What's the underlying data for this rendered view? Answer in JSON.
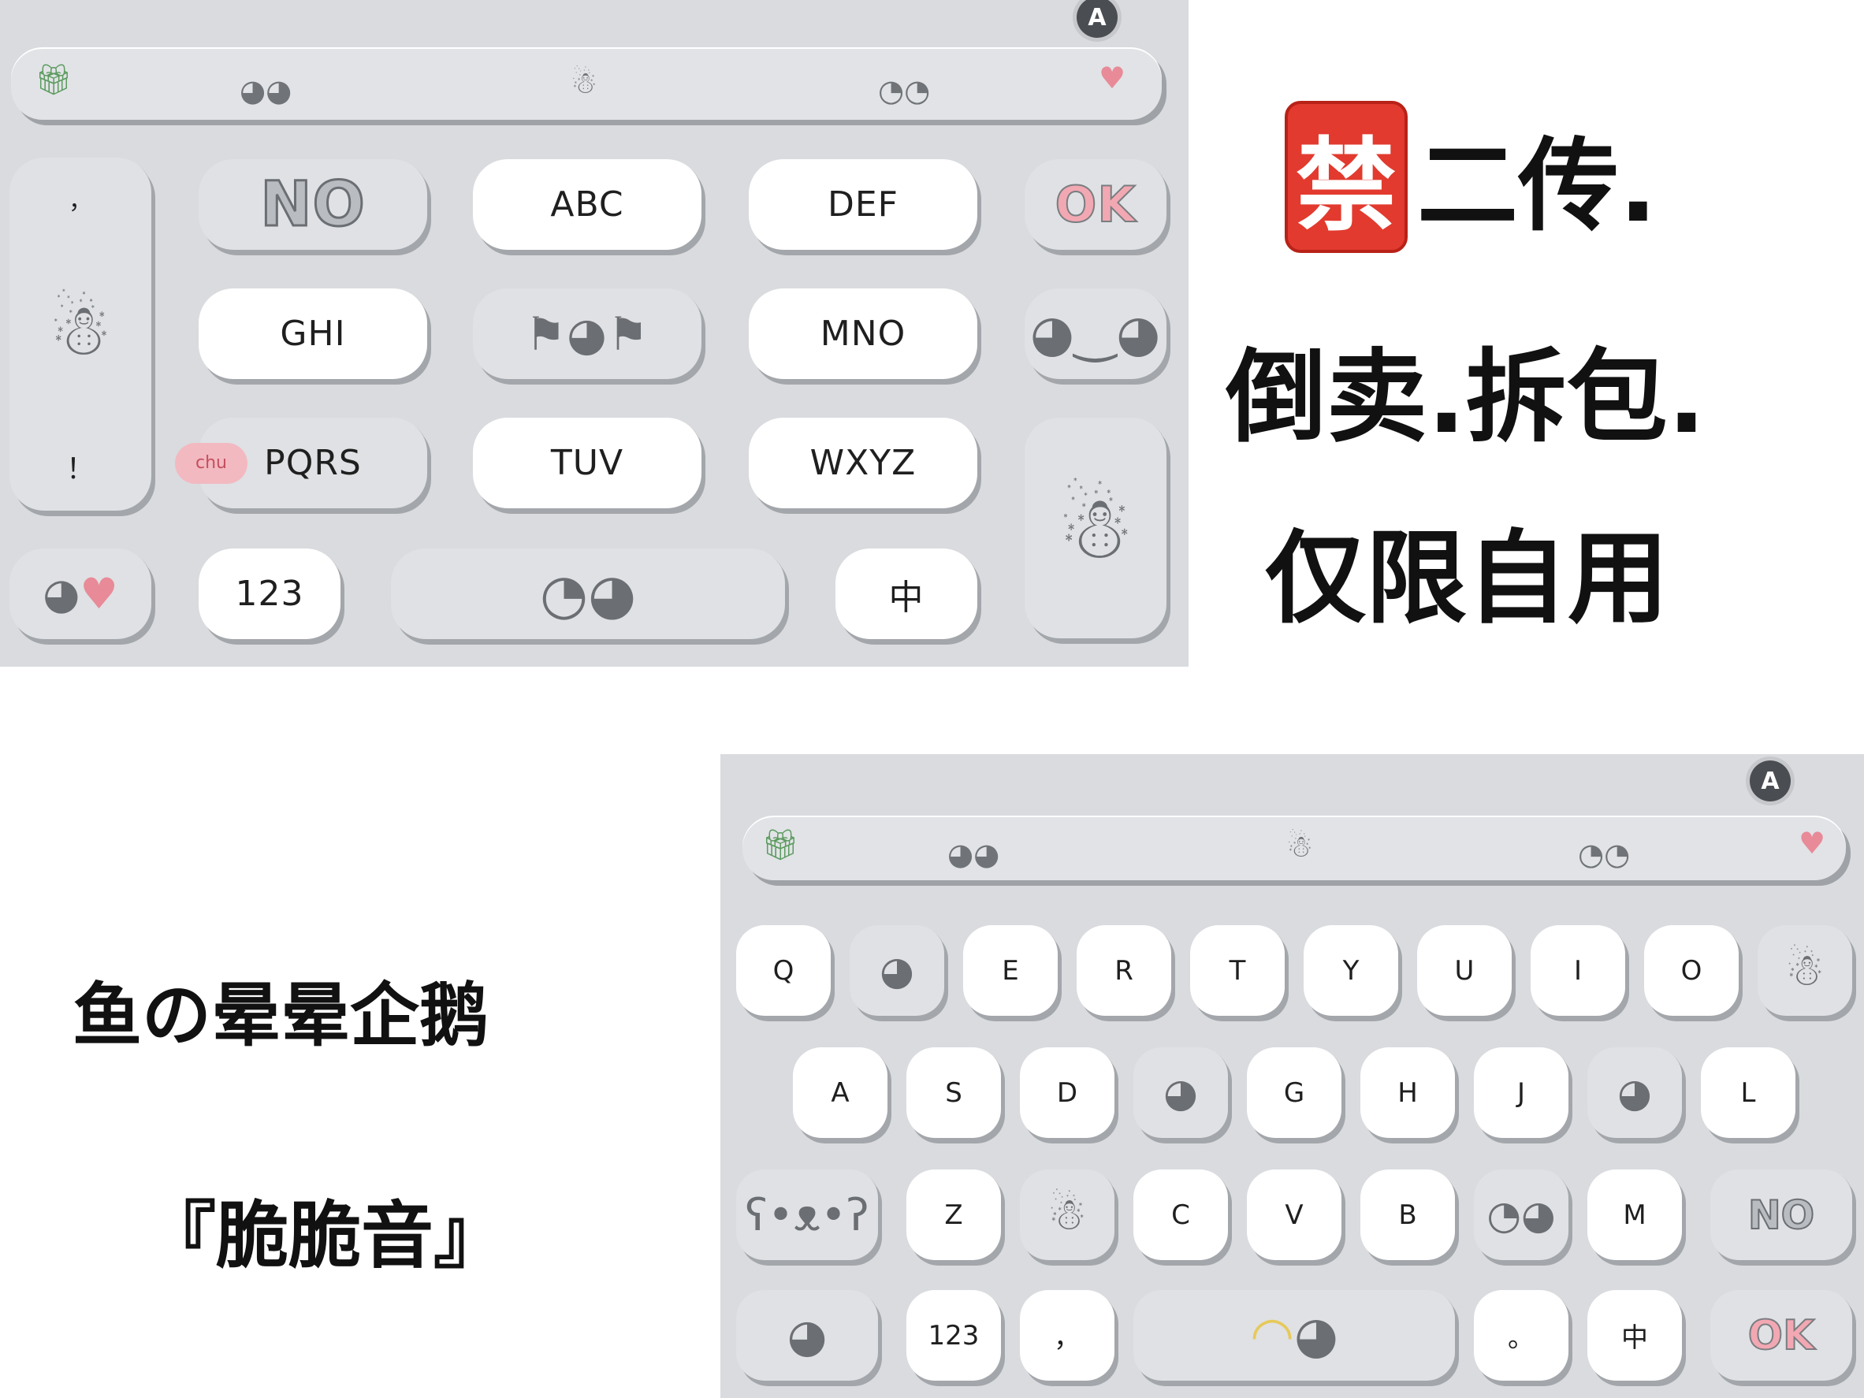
{
  "notice": {
    "ban_glyph": "禁",
    "line1_rest": "二传.",
    "line2": "倒卖.拆包.",
    "line3": "仅限自用"
  },
  "theme": {
    "title": "鱼の晕晕企鹅",
    "subtitle": "『脆脆音』"
  },
  "colors": {
    "keyboard_bg": "#d9dbde",
    "key_white": "#ffffff",
    "key_grey": "#dfe1e4",
    "accent_pink": "#e88a98",
    "ban_red": "#e23a2e"
  },
  "keyboard_t9": {
    "lock_icon": "A",
    "side_punct_top": "，",
    "side_punct_bottom": "！",
    "keys": {
      "abc": "ABC",
      "def": "DEF",
      "ghi": "GHI",
      "mno": "MNO",
      "pqrs": "PQRS",
      "tuv": "TUV",
      "wxyz": "WXYZ",
      "num": "123",
      "lang": "中",
      "chu": "chu"
    },
    "sticker_icons": [
      "gift-icon",
      "penguins-icon",
      "snowman-icon",
      "seal-icon",
      "penguin-heart-icon"
    ]
  },
  "keyboard_qwerty": {
    "lock_icon": "A",
    "row1": [
      "Q",
      "E",
      "R",
      "T",
      "Y",
      "U",
      "I",
      "O"
    ],
    "row2": [
      "A",
      "S",
      "D",
      "G",
      "H",
      "J",
      "L"
    ],
    "row3": [
      "Z",
      "C",
      "V",
      "B",
      "M"
    ],
    "row4": {
      "num": "123",
      "comma": "，",
      "period": "。",
      "lang": "中"
    }
  }
}
